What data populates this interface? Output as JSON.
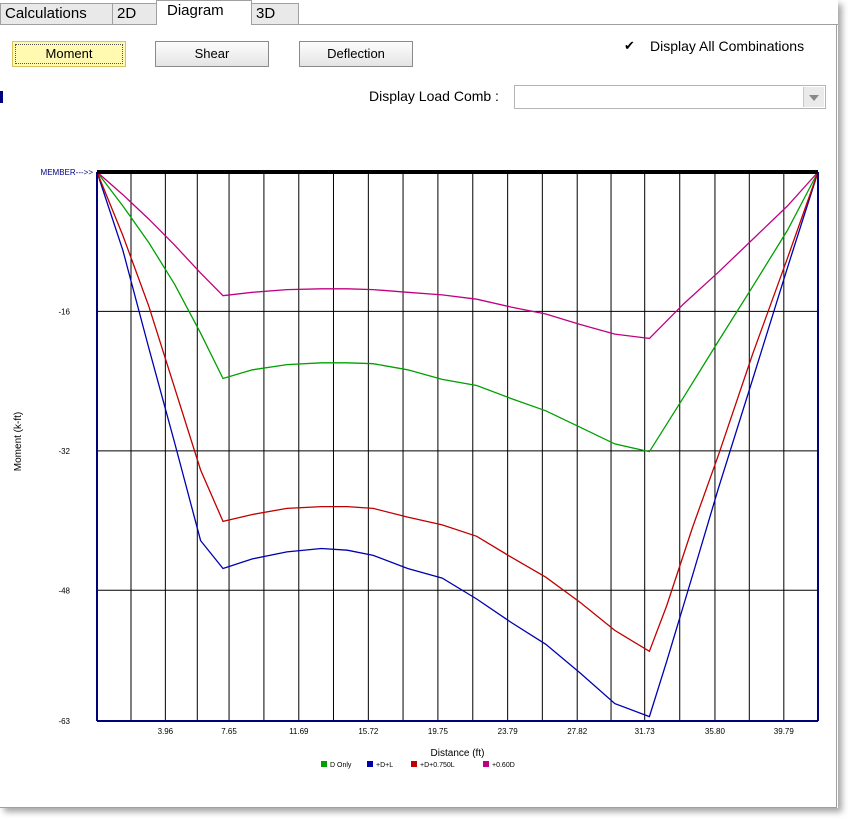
{
  "tabs": [
    {
      "label": "Calculations",
      "active": false
    },
    {
      "label": "2D",
      "active": false
    },
    {
      "label": "Diagram",
      "active": true
    },
    {
      "label": "3D",
      "active": false
    }
  ],
  "toolbar": {
    "moment_label": "Moment",
    "shear_label": "Shear",
    "deflection_label": "Deflection",
    "display_all_label": "Display All Combinations",
    "display_all_checked": true,
    "display_load_comb_label": "Display Load Comb :",
    "display_load_comb_value": ""
  },
  "chart_data": {
    "type": "line",
    "xlabel": "Distance (ft)",
    "ylabel": "Moment (k-ft)",
    "member_label": "MEMBER--->>",
    "xlim": [
      0,
      41.77
    ],
    "ylim": [
      -63,
      0
    ],
    "grid": true,
    "x_ticks": [
      3.96,
      7.65,
      11.69,
      15.72,
      19.75,
      23.79,
      27.82,
      31.73,
      35.8,
      39.79
    ],
    "x_tick_labels": [
      "3.96",
      "7.65",
      "11.69",
      "15.72",
      "19.75",
      "23.79",
      "27.82",
      "31.73",
      "35.80",
      "39.79"
    ],
    "x_minor_ticks": [
      1.97,
      5.81,
      9.67,
      13.7,
      17.73,
      21.77,
      25.8,
      29.78,
      33.76,
      37.79
    ],
    "y_ticks": [
      -16,
      -32,
      -48,
      -63
    ],
    "y_tick_labels": [
      "-16",
      "-32",
      "-48",
      "-63"
    ],
    "legend_position": "bottom",
    "series": [
      {
        "name": "D Only",
        "color": "#00a000",
        "x": [
          0,
          1.5,
          3,
          4.5,
          6,
          7.3,
          9,
          11,
          13,
          14.5,
          16,
          18,
          20,
          22,
          24,
          26,
          28,
          30,
          32,
          34,
          36,
          38,
          40,
          41.77
        ],
        "y": [
          0,
          -3.9,
          -8.1,
          -12.9,
          -18.5,
          -23.7,
          -22.7,
          -22.1,
          -21.9,
          -21.9,
          -22.0,
          -22.7,
          -23.8,
          -24.5,
          -26.0,
          -27.4,
          -29.3,
          -31.2,
          -32.1,
          -25.8,
          -19.4,
          -13.1,
          -6.7,
          0
        ]
      },
      {
        "name": "+D+L",
        "color": "#0000b0",
        "x": [
          0,
          1.5,
          3,
          4.5,
          6,
          7.3,
          9,
          11,
          13,
          14.5,
          16,
          18,
          20,
          22,
          24,
          26,
          28,
          30,
          32,
          33,
          34.5,
          36,
          38,
          40,
          41.77
        ],
        "y": [
          0,
          -9.0,
          -20.2,
          -31.1,
          -42.3,
          -45.5,
          -44.4,
          -43.6,
          -43.2,
          -43.4,
          -44.0,
          -45.5,
          -46.6,
          -49.0,
          -51.7,
          -54.2,
          -57.5,
          -61.0,
          -62.5,
          -56.2,
          -46.3,
          -36.3,
          -23.7,
          -11.0,
          0
        ]
      },
      {
        "name": "+D+0.750L",
        "color": "#c00000",
        "x": [
          0,
          1.5,
          3,
          4.5,
          6,
          7.3,
          9,
          11,
          13,
          14.5,
          16,
          18,
          20,
          22,
          24,
          26,
          28,
          30,
          32,
          33,
          34.5,
          36,
          38,
          40,
          41.77
        ],
        "y": [
          0,
          -7.3,
          -15.4,
          -24.8,
          -34.2,
          -40.1,
          -39.3,
          -38.6,
          -38.4,
          -38.4,
          -38.6,
          -39.6,
          -40.5,
          -41.8,
          -44.2,
          -46.5,
          -49.4,
          -52.6,
          -55.0,
          -49.8,
          -40.8,
          -32.5,
          -20.8,
          -9.9,
          0
        ]
      },
      {
        "name": "+0.60D",
        "color": "#c00080",
        "x": [
          0,
          1.5,
          3,
          4.5,
          6,
          7.3,
          9,
          11,
          13,
          14.5,
          16,
          18,
          20,
          22,
          24,
          26,
          28,
          30,
          32,
          34,
          36,
          38,
          40,
          41.77
        ],
        "y": [
          0,
          -2.6,
          -5.4,
          -8.4,
          -11.6,
          -14.2,
          -13.8,
          -13.5,
          -13.4,
          -13.4,
          -13.5,
          -13.8,
          -14.1,
          -14.6,
          -15.5,
          -16.3,
          -17.5,
          -18.6,
          -19.1,
          -15.1,
          -11.5,
          -7.7,
          -3.9,
          0
        ]
      }
    ]
  }
}
